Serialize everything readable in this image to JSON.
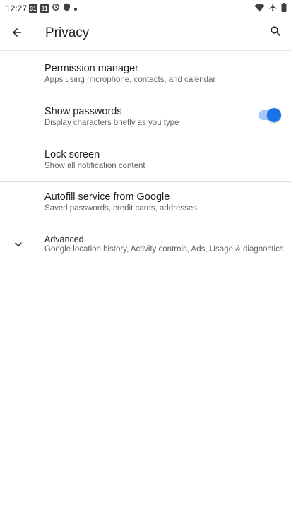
{
  "status_bar": {
    "time": "12:27",
    "left_icons": [
      "calendar-icon",
      "calendar-icon",
      "sync-icon",
      "shield-icon",
      "dot-icon"
    ],
    "calendar_day": "31",
    "right_icons": [
      "wifi-icon",
      "airplane-icon",
      "battery-icon"
    ]
  },
  "app_bar": {
    "title": "Privacy",
    "back_icon": "arrow-back-icon",
    "search_icon": "search-icon"
  },
  "items": [
    {
      "title": "Permission manager",
      "summary": "Apps using microphone, contacts, and calendar"
    },
    {
      "title": "Show passwords",
      "summary": "Display characters briefly as you type",
      "toggle_on": true
    },
    {
      "title": "Lock screen",
      "summary": "Show all notification content"
    },
    {
      "title": "Autofill service from Google",
      "summary": "Saved passwords, credit cards, addresses"
    },
    {
      "title": "Advanced",
      "summary": "Google location history, Activity controls, Ads, Usage & diagnostics",
      "icon": "chevron-down-icon"
    }
  ],
  "colors": {
    "accent": "#1a73e8",
    "toggle_track": "#a8c7fa",
    "text_primary": "#202124",
    "text_secondary": "#5f6368",
    "divider": "#dadce0"
  }
}
